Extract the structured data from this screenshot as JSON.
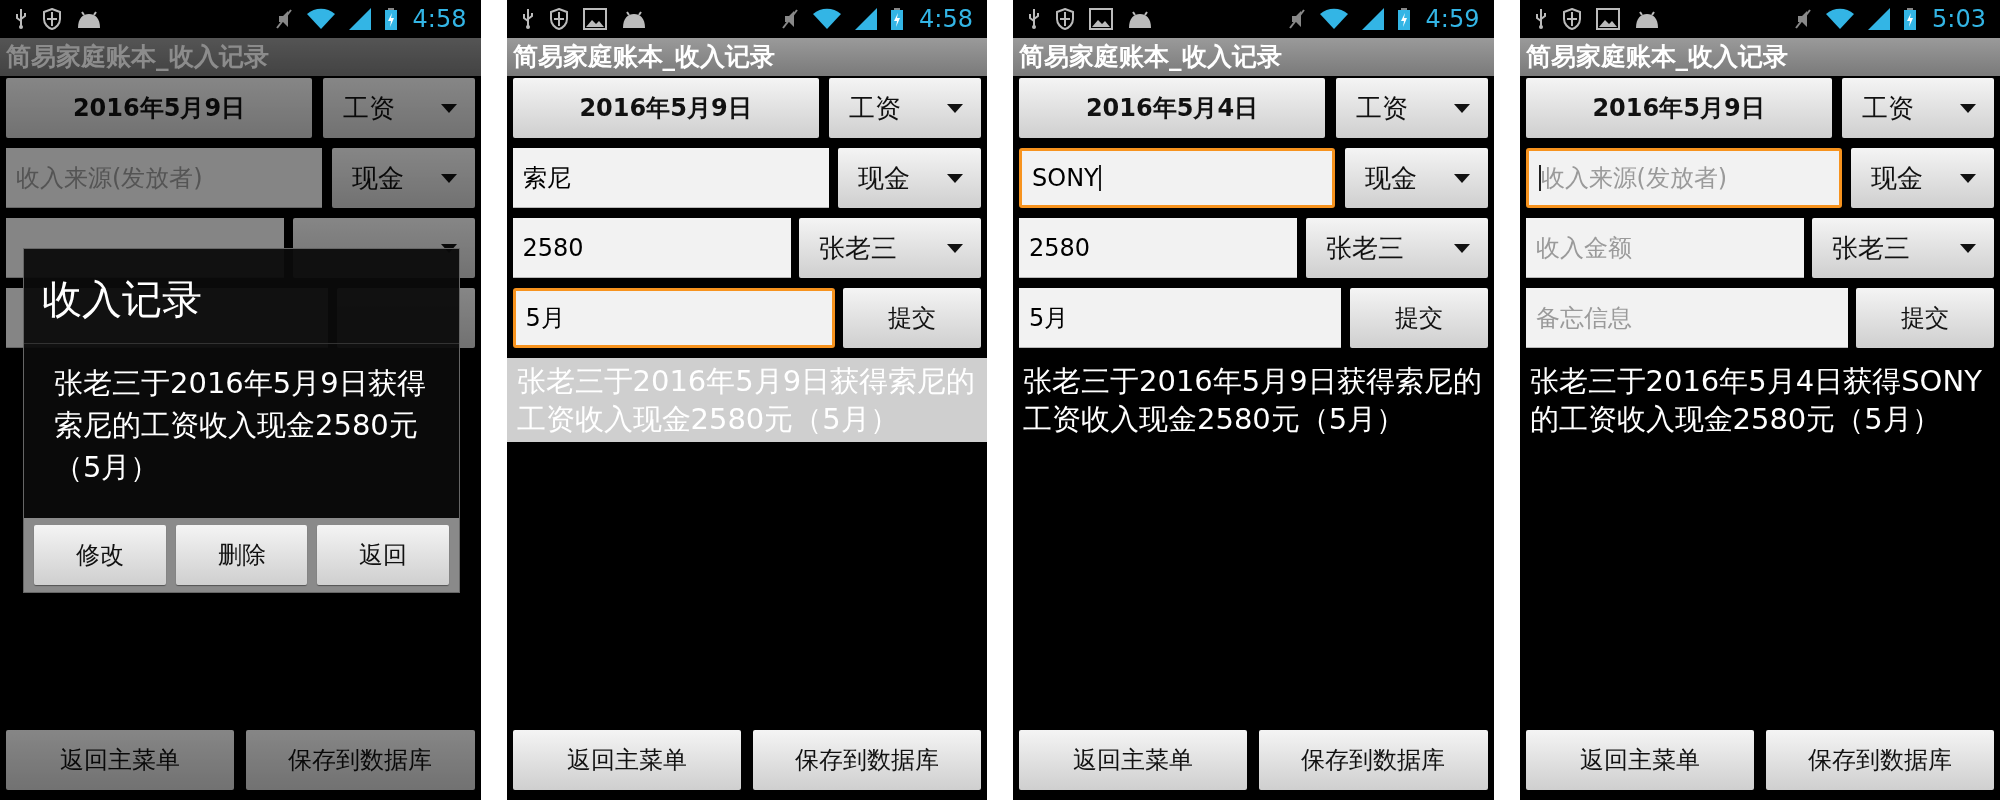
{
  "screens": [
    {
      "status_bar": {
        "time": "4:58",
        "picture_notification": false
      },
      "title": "简易家庭账本_收入记录",
      "dimmed": true,
      "date_button": "2016年5月9日",
      "category_spinner": "工资",
      "source_field": {
        "placeholder": "收入来源(发放者)",
        "focused": false,
        "cursor": false
      },
      "payment_spinner": "现金",
      "amount_field": {
        "focused": false,
        "cursor": false
      },
      "memo_field": {
        "focused": false,
        "cursor": false
      },
      "bottom_buttons": [
        "返回主菜单",
        "保存到数据库"
      ],
      "dialog": {
        "title": "收入记录",
        "message": "张老三于2016年5月9日获得索尼的工资收入现金2580元（5月）",
        "buttons": [
          "修改",
          "删除",
          "返回"
        ]
      }
    },
    {
      "status_bar": {
        "time": "4:58",
        "picture_notification": true
      },
      "title": "简易家庭账本_收入记录",
      "dimmed": false,
      "date_button": "2016年5月9日",
      "category_spinner": "工资",
      "source_field": {
        "value": "索尼",
        "focused": false,
        "cursor": false
      },
      "payment_spinner": "现金",
      "amount_field": {
        "value": "2580",
        "focused": false,
        "cursor": false
      },
      "person_spinner": "张老三",
      "memo_field": {
        "value": "5月",
        "focused": true,
        "cursor": false
      },
      "submit_button": "提交",
      "result": {
        "text": "张老三于2016年5月9日获得索尼的工资收入现金2580元（5月）",
        "highlighted": true
      },
      "bottom_buttons": [
        "返回主菜单",
        "保存到数据库"
      ]
    },
    {
      "status_bar": {
        "time": "4:59",
        "picture_notification": true
      },
      "title": "简易家庭账本_收入记录",
      "dimmed": false,
      "date_button": "2016年5月4日",
      "category_spinner": "工资",
      "source_field": {
        "value": "SONY",
        "focused": true,
        "cursor": true
      },
      "payment_spinner": "现金",
      "amount_field": {
        "value": "2580",
        "focused": false,
        "cursor": false
      },
      "person_spinner": "张老三",
      "memo_field": {
        "value": "5月",
        "focused": false,
        "cursor": false
      },
      "submit_button": "提交",
      "result": {
        "text": "张老三于2016年5月9日获得索尼的工资收入现金2580元（5月）",
        "highlighted": false
      },
      "bottom_buttons": [
        "返回主菜单",
        "保存到数据库"
      ]
    },
    {
      "status_bar": {
        "time": "5:03",
        "picture_notification": true
      },
      "title": "简易家庭账本_收入记录",
      "dimmed": false,
      "date_button": "2016年5月9日",
      "category_spinner": "工资",
      "source_field": {
        "placeholder": "收入来源(发放者)",
        "focused": true,
        "cursor": true
      },
      "payment_spinner": "现金",
      "amount_field": {
        "placeholder": "收入金额",
        "focused": false,
        "cursor": false
      },
      "person_spinner": "张老三",
      "memo_field": {
        "placeholder": "备忘信息",
        "focused": false,
        "cursor": false
      },
      "submit_button": "提交",
      "result": {
        "text": "张老三于2016年5月4日获得SONY的工资收入现金2580元（5月）",
        "highlighted": false
      },
      "bottom_buttons": [
        "返回主菜单",
        "保存到数据库"
      ]
    }
  ]
}
